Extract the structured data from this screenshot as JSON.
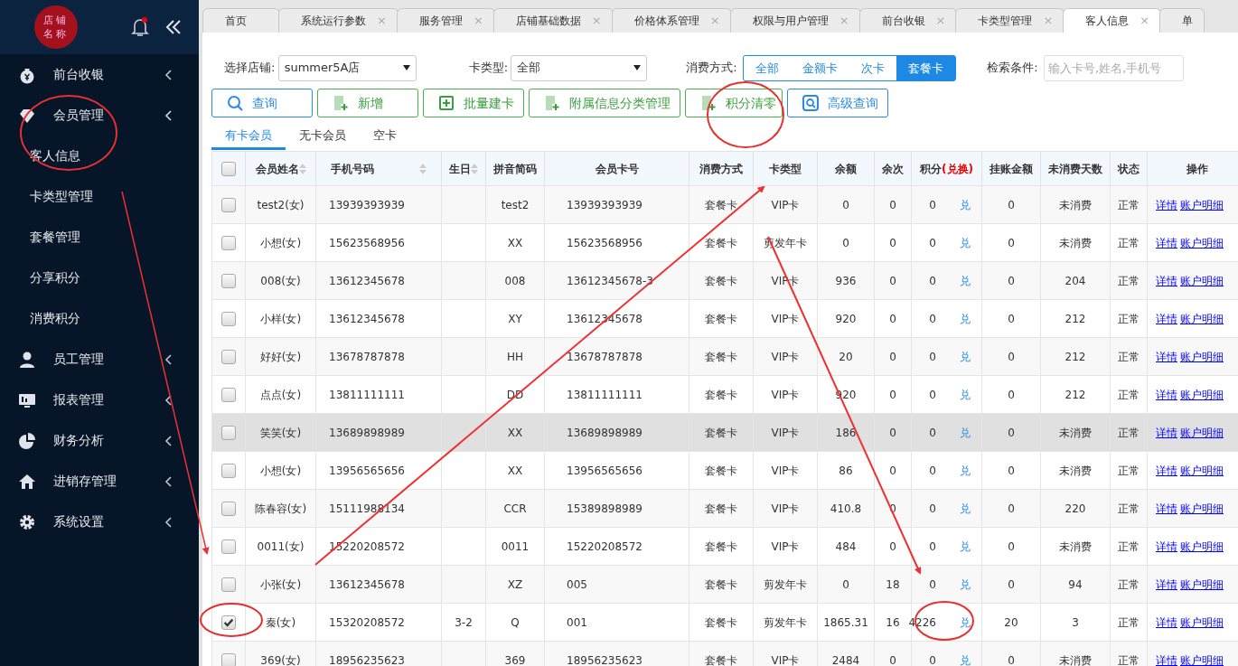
{
  "sidebar": {
    "logo": [
      "店铺",
      "名称"
    ],
    "items": [
      {
        "label": "前台收银",
        "expanded": false
      },
      {
        "label": "会员管理",
        "expanded": true,
        "children": [
          {
            "label": "客人信息"
          },
          {
            "label": "卡类型管理"
          },
          {
            "label": "套餐管理"
          },
          {
            "label": "分享积分"
          },
          {
            "label": "消费积分"
          }
        ]
      },
      {
        "label": "员工管理",
        "expanded": false
      },
      {
        "label": "报表管理",
        "expanded": false
      },
      {
        "label": "财务分析",
        "expanded": false
      },
      {
        "label": "进销存管理",
        "expanded": false
      },
      {
        "label": "系统设置",
        "expanded": false
      }
    ]
  },
  "tabs": [
    {
      "label": "首页",
      "closable": false,
      "selected": false
    },
    {
      "label": "系统运行参数",
      "closable": true,
      "selected": false
    },
    {
      "label": "服务管理",
      "closable": true,
      "selected": false
    },
    {
      "label": "店铺基础数据",
      "closable": true,
      "selected": false
    },
    {
      "label": "价格体系管理",
      "closable": true,
      "selected": false
    },
    {
      "label": "权限与用户管理",
      "closable": true,
      "selected": false
    },
    {
      "label": "前台收银",
      "closable": true,
      "selected": false
    },
    {
      "label": "卡类型管理",
      "closable": true,
      "selected": false
    },
    {
      "label": "客人信息",
      "closable": true,
      "selected": true
    },
    {
      "label": "单",
      "closable": false,
      "selected": false
    }
  ],
  "close_symbol": "×",
  "filters": {
    "store_label": "选择店铺:",
    "store_value": "summer5A店",
    "card_type_label": "卡类型:",
    "card_type_value": "全部",
    "consume_label": "消费方式:",
    "consume_options": [
      {
        "label": "全部",
        "selected": false
      },
      {
        "label": "金额卡",
        "selected": false
      },
      {
        "label": "次卡",
        "selected": false
      },
      {
        "label": "套餐卡",
        "selected": true
      }
    ],
    "search_label": "检索条件:",
    "search_placeholder": "输入卡号,姓名,手机号"
  },
  "buttons": [
    {
      "label": "查询",
      "kind": "primary"
    },
    {
      "label": "新增",
      "kind": "success"
    },
    {
      "label": "批量建卡",
      "kind": "success"
    },
    {
      "label": "附属信息分类管理",
      "kind": "success"
    },
    {
      "label": "积分清零",
      "kind": "success"
    },
    {
      "label": "高级查询",
      "kind": "primary"
    }
  ],
  "member_tabs": [
    {
      "label": "有卡会员",
      "selected": true
    },
    {
      "label": "无卡会员",
      "selected": false
    },
    {
      "label": "空卡",
      "selected": false
    }
  ],
  "table": {
    "header_checked": false,
    "columns": [
      {
        "label": "会员姓名",
        "sortable": true
      },
      {
        "label": "手机号码",
        "sortable": true
      },
      {
        "label": "生日",
        "sortable": true
      },
      {
        "label": "拼音简码",
        "sortable": false
      },
      {
        "label": "会员卡号",
        "sortable": false
      },
      {
        "label": "消费方式",
        "sortable": false
      },
      {
        "label": "卡类型",
        "sortable": false
      },
      {
        "label": "余额",
        "sortable": false
      },
      {
        "label": "余次",
        "sortable": false
      },
      {
        "label": "积分",
        "note": "(兑换)",
        "sortable": false
      },
      {
        "label": "挂账金额",
        "sortable": false
      },
      {
        "label": "未消费天数",
        "sortable": false
      },
      {
        "label": "状态",
        "sortable": false
      },
      {
        "label": "操作",
        "sortable": false
      }
    ],
    "rows": [
      {
        "checked": false,
        "highlighted": false,
        "name": "test2(女)",
        "phone": "13939393939",
        "pinyin": "test2",
        "card_no": "13939393939",
        "consume": "套餐卡",
        "card_type": "VIP卡",
        "balance": "0",
        "times": "0",
        "points": "0",
        "exchange": "兑",
        "credit": "0",
        "idle_days": "未消费",
        "status": "正常",
        "actions": [
          "详情",
          "账户明细"
        ]
      },
      {
        "checked": false,
        "highlighted": false,
        "name": "小想(女)",
        "phone": "15623568956",
        "pinyin": "XX",
        "card_no": "15623568956",
        "consume": "套餐卡",
        "card_type": "剪发年卡",
        "balance": "0",
        "times": "0",
        "points": "0",
        "exchange": "兑",
        "credit": "0",
        "idle_days": "未消费",
        "status": "正常",
        "actions": [
          "详情",
          "账户明细"
        ]
      },
      {
        "checked": false,
        "highlighted": false,
        "name": "008(女)",
        "phone": "13612345678",
        "pinyin": "008",
        "card_no": "13612345678-3",
        "consume": "套餐卡",
        "card_type": "VIP卡",
        "balance": "936",
        "times": "0",
        "points": "0",
        "exchange": "兑",
        "credit": "0",
        "idle_days": "204",
        "status": "正常",
        "actions": [
          "详情",
          "账户明细"
        ]
      },
      {
        "checked": false,
        "highlighted": false,
        "name": "小样(女)",
        "phone": "13612345678",
        "pinyin": "XY",
        "card_no": "13612345678",
        "consume": "套餐卡",
        "card_type": "VIP卡",
        "balance": "920",
        "times": "0",
        "points": "0",
        "exchange": "兑",
        "credit": "0",
        "idle_days": "212",
        "status": "正常",
        "actions": [
          "详情",
          "账户明细"
        ]
      },
      {
        "checked": false,
        "highlighted": false,
        "name": "好好(女)",
        "phone": "13678787878",
        "pinyin": "HH",
        "card_no": "13678787878",
        "consume": "套餐卡",
        "card_type": "VIP卡",
        "balance": "20",
        "times": "0",
        "points": "0",
        "exchange": "兑",
        "credit": "0",
        "idle_days": "212",
        "status": "正常",
        "actions": [
          "详情",
          "账户明细"
        ]
      },
      {
        "checked": false,
        "highlighted": false,
        "name": "点点(女)",
        "phone": "13811111111",
        "pinyin": "DD",
        "card_no": "13811111111",
        "consume": "套餐卡",
        "card_type": "VIP卡",
        "balance": "920",
        "times": "0",
        "points": "0",
        "exchange": "兑",
        "credit": "0",
        "idle_days": "212",
        "status": "正常",
        "actions": [
          "详情",
          "账户明细"
        ]
      },
      {
        "checked": false,
        "highlighted": true,
        "name": "笑笑(女)",
        "phone": "13689898989",
        "pinyin": "XX",
        "card_no": "13689898989",
        "consume": "套餐卡",
        "card_type": "VIP卡",
        "balance": "186",
        "times": "0",
        "points": "0",
        "exchange": "兑",
        "credit": "0",
        "idle_days": "未消费",
        "status": "正常",
        "actions": [
          "详情",
          "账户明细"
        ]
      },
      {
        "checked": false,
        "highlighted": false,
        "name": "小想(女)",
        "phone": "13956565656",
        "pinyin": "XX",
        "card_no": "13956565656",
        "consume": "套餐卡",
        "card_type": "VIP卡",
        "balance": "86",
        "times": "0",
        "points": "0",
        "exchange": "兑",
        "credit": "0",
        "idle_days": "未消费",
        "status": "正常",
        "actions": [
          "详情",
          "账户明细"
        ]
      },
      {
        "checked": false,
        "highlighted": false,
        "name": "陈春容(女)",
        "phone": "15111988134",
        "pinyin": "CCR",
        "card_no": "15389898989",
        "consume": "套餐卡",
        "card_type": "VIP卡",
        "balance": "410.8",
        "times": "0",
        "points": "0",
        "exchange": "兑",
        "credit": "0",
        "idle_days": "220",
        "status": "正常",
        "actions": [
          "详情",
          "账户明细"
        ]
      },
      {
        "checked": false,
        "highlighted": false,
        "name": "0011(女)",
        "phone": "15220208572",
        "pinyin": "0011",
        "card_no": "15220208572",
        "consume": "套餐卡",
        "card_type": "VIP卡",
        "balance": "484",
        "times": "0",
        "points": "0",
        "exchange": "兑",
        "credit": "0",
        "idle_days": "未消费",
        "status": "正常",
        "actions": [
          "详情",
          "账户明细"
        ]
      },
      {
        "checked": false,
        "highlighted": false,
        "name": "小张(女)",
        "phone": "13612345678",
        "pinyin": "XZ",
        "card_no": "005",
        "consume": "套餐卡",
        "card_type": "剪发年卡",
        "balance": "0",
        "times": "18",
        "points": "0",
        "exchange": "兑",
        "credit": "0",
        "idle_days": "94",
        "status": "正常",
        "actions": [
          "详情",
          "账户明细"
        ]
      },
      {
        "checked": true,
        "highlighted": false,
        "name": "秦(女)",
        "phone": "15320208572",
        "birthday": "3-2",
        "pinyin": "Q",
        "card_no": "001",
        "consume": "套餐卡",
        "card_type": "剪发年卡",
        "balance": "1865.31",
        "times": "16",
        "points": "4226",
        "exchange": "兑",
        "credit": "20",
        "idle_days": "3",
        "status": "正常",
        "actions": [
          "详情",
          "账户明细"
        ]
      },
      {
        "checked": false,
        "highlighted": false,
        "name": "369(女)",
        "phone": "18956235623",
        "pinyin": "369",
        "card_no": "18956235623",
        "consume": "套餐卡",
        "card_type": "VIP卡",
        "balance": "2484",
        "times": "0",
        "points": "0",
        "exchange": "兑",
        "credit": "0",
        "idle_days": "未消费",
        "status": "正常",
        "actions": [
          "详情",
          "账户明细"
        ]
      }
    ]
  }
}
